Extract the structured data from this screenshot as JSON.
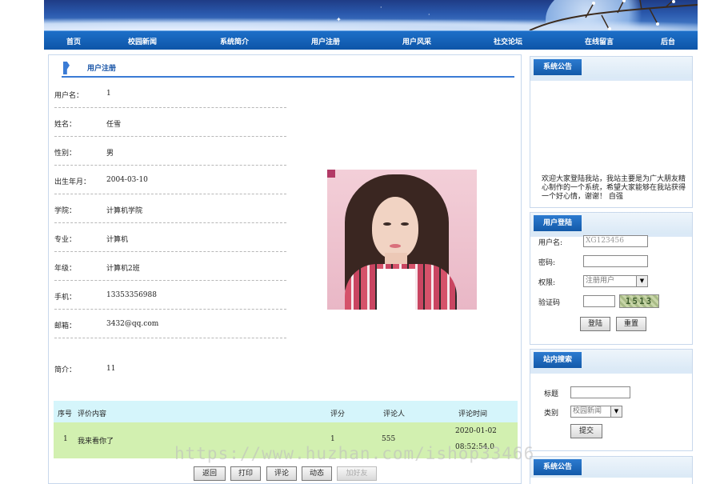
{
  "nav": {
    "items": [
      "首页",
      "校园新闻",
      "系统简介",
      "用户注册",
      "用户风采",
      "社交论坛",
      "在线留言",
      "后台"
    ]
  },
  "main": {
    "title": "用户注册",
    "fields": [
      {
        "label": "用户名：",
        "value": "1"
      },
      {
        "label": "姓名：",
        "value": "任雪"
      },
      {
        "label": "性别：",
        "value": "男"
      },
      {
        "label": "出生年月：",
        "value": "2004-03-10"
      },
      {
        "label": "学院：",
        "value": "计算机学院"
      },
      {
        "label": "专业：",
        "value": "计算机"
      },
      {
        "label": "年级：",
        "value": "计算机2班"
      },
      {
        "label": "手机：",
        "value": "13353356988"
      },
      {
        "label": "邮箱：",
        "value": "3432@qq.com"
      },
      {
        "label": "简介：",
        "value": "11"
      }
    ],
    "review_table": {
      "headers": [
        "序号",
        "评价内容",
        "评分",
        "评论人",
        "评论时间"
      ],
      "rows": [
        {
          "index": "1",
          "content": "我来看你了",
          "score": "1",
          "reviewer": "555",
          "date": "2020-01-02",
          "time": "08:52:54.0"
        }
      ]
    },
    "buttons": [
      "返回",
      "打印",
      "评论",
      "动态",
      "加好友"
    ]
  },
  "watermark": "https://www.huzhan.com/ishop33466",
  "sidebar": {
    "notice": {
      "title": "系统公告",
      "text": "欢迎大家登陆我站，我站主要是为广大朋友精心制作的一个系统，希望大家能够在我站获得一个好心情，谢谢！ 自强"
    },
    "login": {
      "title": "用户登陆",
      "username_label": "用户名:",
      "username_value": "XG123456",
      "password_label": "密码:",
      "role_label": "权限:",
      "role_value": "注册用户",
      "captcha_label": "验证码",
      "captcha_code": "1513",
      "login_button": "登陆",
      "reset_button": "重置"
    },
    "search": {
      "title": "站内搜索",
      "title_label": "标题",
      "category_label": "类别",
      "category_value": "校园新闻",
      "submit_button": "提交"
    },
    "notice2": {
      "title": "系统公告"
    }
  },
  "colors": {
    "nav": "#0d55a8",
    "accent": "#3a7bd5",
    "table_header": "#d5f5fb",
    "table_row": "#d2f0b0"
  }
}
